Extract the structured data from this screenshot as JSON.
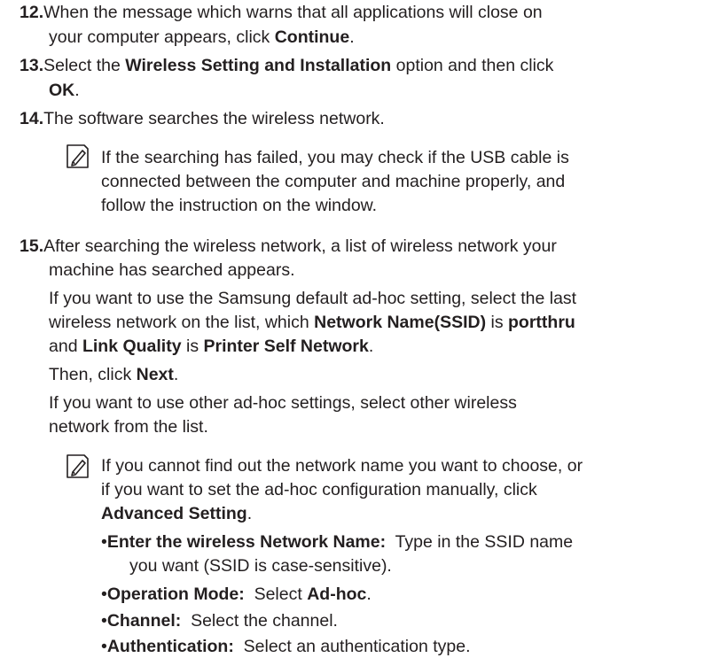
{
  "steps": {
    "s12": {
      "num": "12.",
      "l1": "When the message which warns that all applications will close on",
      "l2a": "your computer appears, click ",
      "l2b": "Continue",
      "l2c": "."
    },
    "s13": {
      "num": "13.",
      "l1a": "Select the ",
      "l1b": "Wireless Setting and Installation",
      "l1c": " option and then click",
      "l2a": "OK",
      "l2b": "."
    },
    "s14": {
      "num": "14.",
      "l1": "The software searches the wireless network.",
      "note": {
        "l1": "If the searching has failed, you may check if the USB cable is",
        "l2": "connected between the computer and machine properly, and",
        "l3": "follow the instruction on the window."
      }
    },
    "s15": {
      "num": "15.",
      "l1": "After searching the wireless network, a list of wireless network your",
      "l2": "machine has searched appears.",
      "p2l1": "If you want to use the Samsung default ad-hoc setting, select the last",
      "p2l2a": "wireless network on the list, which ",
      "p2l2b": "Network Name(SSID)",
      "p2l2c": " is ",
      "p2l2d": "portthru",
      "p2l3a": "and ",
      "p2l3b": "Link Quality",
      "p2l3c": " is ",
      "p2l3d": "Printer Self Network",
      "p2l3e": ".",
      "p3a": "Then, click ",
      "p3b": "Next",
      "p3c": ".",
      "p4l1": "If you want to use other ad-hoc settings, select other wireless",
      "p4l2": "network from the list.",
      "note": {
        "l1": "If you cannot find out the network name you want to choose, or",
        "l2": "if you want to set the ad-hoc configuration manually, click",
        "l3": "Advanced Setting",
        "l3b": "."
      },
      "bullets": [
        {
          "mark": "•",
          "label": "Enter the wireless Network Name:",
          "text": "  Type in the SSID name",
          "cont": "you want (SSID is case-sensitive)."
        },
        {
          "mark": "•",
          "label": "Operation Mode:",
          "text": "  Select ",
          "bold2": "Ad-hoc",
          "end": "."
        },
        {
          "mark": "•",
          "label": "Channel:",
          "text": "  Select the channel."
        },
        {
          "mark": "•",
          "label": "Authentication:",
          "text": "  Select an authentication type."
        }
      ]
    }
  },
  "icons": {
    "note": "note-pencil-icon"
  }
}
